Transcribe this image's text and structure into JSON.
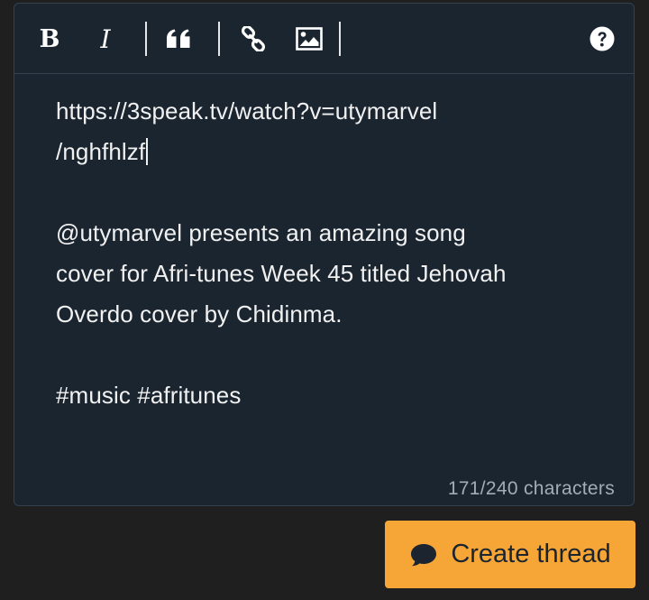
{
  "toolbar": {
    "bold_label": "B",
    "italic_label": "I",
    "icons": [
      "quote-icon",
      "link-icon",
      "image-icon",
      "help-icon"
    ]
  },
  "editor": {
    "lines": [
      "https://3speak.tv/watch?v=utymarvel",
      "/nghfhlzf",
      "",
      "@utymarvel presents an amazing song",
      "cover for Afri-tunes Week 45 titled Jehovah",
      "Overdo cover by Chidinma.",
      "",
      "#music #afritunes"
    ],
    "char_count": "171/240 characters"
  },
  "actions": {
    "create_label": "Create thread",
    "create_icon": "speech-bubble-icon"
  },
  "colors": {
    "page_bg": "#1f1f1f",
    "editor_bg": "#1b2530",
    "border": "#34414f",
    "text": "#f1f1f1",
    "muted": "#a3acb6",
    "accent": "#f5a636"
  }
}
